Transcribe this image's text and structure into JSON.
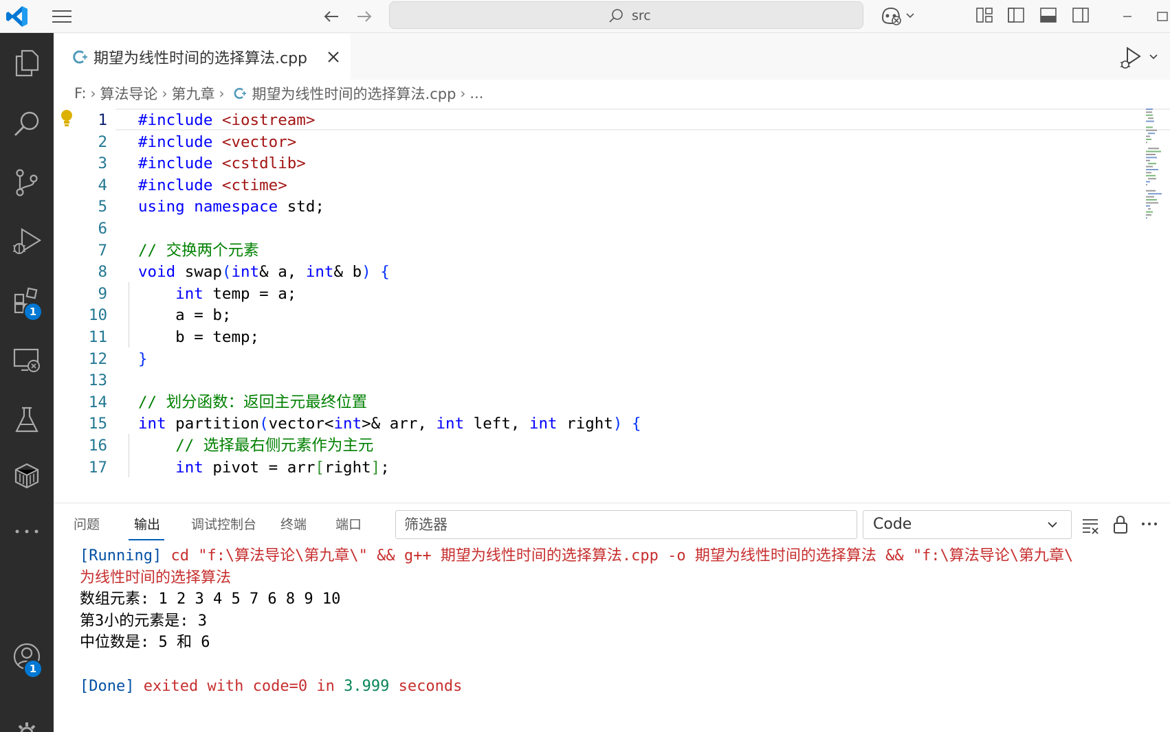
{
  "titlebar": {
    "command_center_label": "src"
  },
  "activity_badges": {
    "extensions": "1",
    "accounts": "1"
  },
  "editor": {
    "tab_label": "期望为线性时间的选择算法.cpp",
    "breadcrumb": {
      "drive": "F:",
      "folder1": "算法导论",
      "folder2": "第九章",
      "file": "期望为线性时间的选择算法.cpp",
      "more": "..."
    },
    "line_numbers": [
      "1",
      "2",
      "3",
      "4",
      "5",
      "6",
      "7",
      "8",
      "9",
      "10",
      "11",
      "12",
      "13",
      "14",
      "15",
      "16",
      "17"
    ],
    "lines": [
      [
        {
          "t": "#include ",
          "c": "pp"
        },
        {
          "t": "<iostream>",
          "c": "st"
        }
      ],
      [
        {
          "t": "#include ",
          "c": "pp"
        },
        {
          "t": "<vector>",
          "c": "st"
        }
      ],
      [
        {
          "t": "#include ",
          "c": "pp"
        },
        {
          "t": "<cstdlib>",
          "c": "st"
        }
      ],
      [
        {
          "t": "#include ",
          "c": "pp"
        },
        {
          "t": "<ctime>",
          "c": "st"
        }
      ],
      [
        {
          "t": "using",
          "c": "kw"
        },
        {
          "t": " "
        },
        {
          "t": "namespace",
          "c": "kw"
        },
        {
          "t": " std;"
        }
      ],
      [],
      [
        {
          "t": "// 交换两个元素",
          "c": "cm"
        }
      ],
      [
        {
          "t": "void",
          "c": "kw"
        },
        {
          "t": " swap"
        },
        {
          "t": "(",
          "c": "br"
        },
        {
          "t": "int",
          "c": "kw"
        },
        {
          "t": "& a, "
        },
        {
          "t": "int",
          "c": "kw"
        },
        {
          "t": "& b"
        },
        {
          "t": ")",
          "c": "br"
        },
        {
          "t": " "
        },
        {
          "t": "{",
          "c": "br"
        }
      ],
      [
        {
          "t": "    "
        },
        {
          "t": "int",
          "c": "kw"
        },
        {
          "t": " temp = a;"
        }
      ],
      [
        {
          "t": "    a = b;"
        }
      ],
      [
        {
          "t": "    b = temp;"
        }
      ],
      [
        {
          "t": "}",
          "c": "br"
        }
      ],
      [],
      [
        {
          "t": "// 划分函数：返回主元最终位置",
          "c": "cm"
        }
      ],
      [
        {
          "t": "int",
          "c": "kw"
        },
        {
          "t": " partition"
        },
        {
          "t": "(",
          "c": "br"
        },
        {
          "t": "vector<"
        },
        {
          "t": "int",
          "c": "kw"
        },
        {
          "t": ">& arr, "
        },
        {
          "t": "int",
          "c": "kw"
        },
        {
          "t": " left, "
        },
        {
          "t": "int",
          "c": "kw"
        },
        {
          "t": " right"
        },
        {
          "t": ")",
          "c": "br"
        },
        {
          "t": " "
        },
        {
          "t": "{",
          "c": "br"
        }
      ],
      [
        {
          "t": "    "
        },
        {
          "t": "// 选择最右侧元素作为主元",
          "c": "cm"
        }
      ],
      [
        {
          "t": "    "
        },
        {
          "t": "int",
          "c": "kw"
        },
        {
          "t": " pivot = arr"
        },
        {
          "t": "[",
          "c": "br2"
        },
        {
          "t": "right"
        },
        {
          "t": "]",
          "c": "br2"
        },
        {
          "t": ";"
        }
      ]
    ]
  },
  "panel": {
    "tabs": [
      "问题",
      "输出",
      "调试控制台",
      "终端",
      "端口"
    ],
    "active_tab": "输出",
    "filter_placeholder": "筛选器",
    "output_channel": "Code",
    "output_lines": [
      [
        {
          "t": "[Running]",
          "c": "o-run"
        },
        {
          "t": " cd \"f:\\算法导论\\第九章\\\" && g++ 期望为线性时间的选择算法.cpp -o 期望为线性时间的选择算法 && \"f:\\算法导论\\第九章\\",
          "c": "o-cmd"
        }
      ],
      [
        {
          "t": "为线性时间的选择算法",
          "c": "o-cmd"
        }
      ],
      [
        {
          "t": "数组元素: 1 2 3 4 5 7 6 8 9 10",
          "c": "o-plain"
        }
      ],
      [
        {
          "t": "第3小的元素是: 3",
          "c": "o-plain"
        }
      ],
      [
        {
          "t": "中位数是: 5 和 6",
          "c": "o-plain"
        }
      ],
      [],
      [
        {
          "t": "[Done]",
          "c": "o-run"
        },
        {
          "t": " exited with ",
          "c": "o-cmd"
        },
        {
          "t": "code=0",
          "c": "o-cmd"
        },
        {
          "t": " in ",
          "c": "o-cmd"
        },
        {
          "t": "3.999",
          "c": "o-num"
        },
        {
          "t": " seconds",
          "c": "o-cmd"
        }
      ]
    ]
  },
  "colors": {
    "activity_bar": "#2c2c2c",
    "badge": "#0078d4",
    "keyword": "#0000ff",
    "comment": "#008000",
    "string": "#a31515",
    "line_number": "#237893"
  }
}
